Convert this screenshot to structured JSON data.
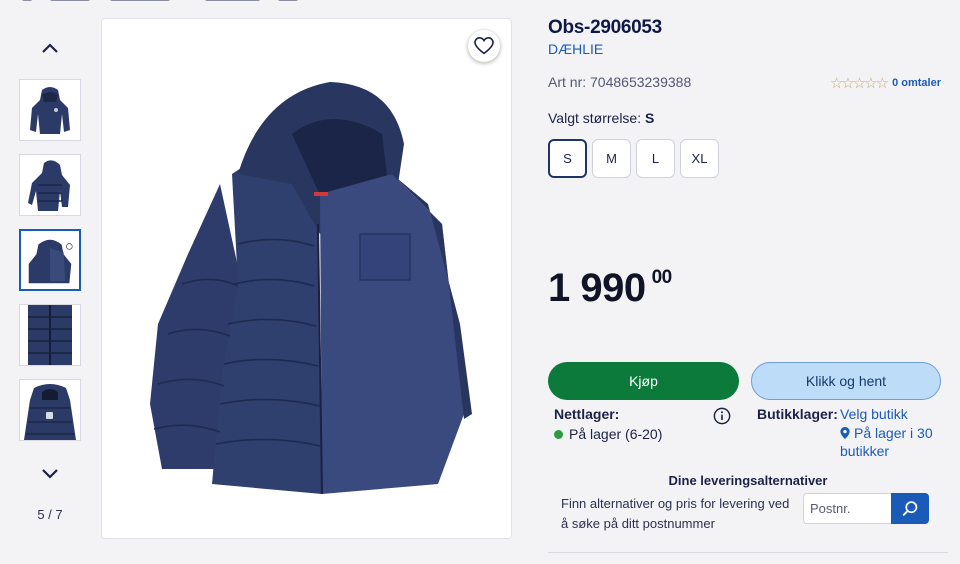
{
  "gallery": {
    "counter": "5 / 7"
  },
  "product": {
    "title": "Obs-2906053",
    "brand": "DÆHLIE",
    "art_nr": "Art nr: 7048653239388",
    "rating_stars": "☆☆☆☆☆",
    "reviews": "0 omtaler",
    "size_label_prefix": "Valgt størrelse:",
    "size_selected": "S",
    "sizes": [
      "S",
      "M",
      "L",
      "XL"
    ],
    "price_main": "1 990",
    "price_decimals": "00"
  },
  "actions": {
    "buy": "Kjøp",
    "click_collect": "Klikk og hent"
  },
  "stock": {
    "net_label": "Nettlager:",
    "net_status": "På lager (6-20)",
    "store_label": "Butikklager:",
    "store_link": "Velg butikk",
    "store_status": "På lager i 30 butikker"
  },
  "delivery": {
    "title": "Dine leveringsalternativer",
    "text": "Finn alternativer og pris for levering ved å søke på ditt postnummer",
    "postnr_placeholder": "Postnr."
  },
  "colors": {
    "brand_blue": "#1a5bb8",
    "buy_green": "#0b7a3a",
    "collect_bg": "#bcdcf7",
    "jacket_navy": "#2b3a66"
  }
}
